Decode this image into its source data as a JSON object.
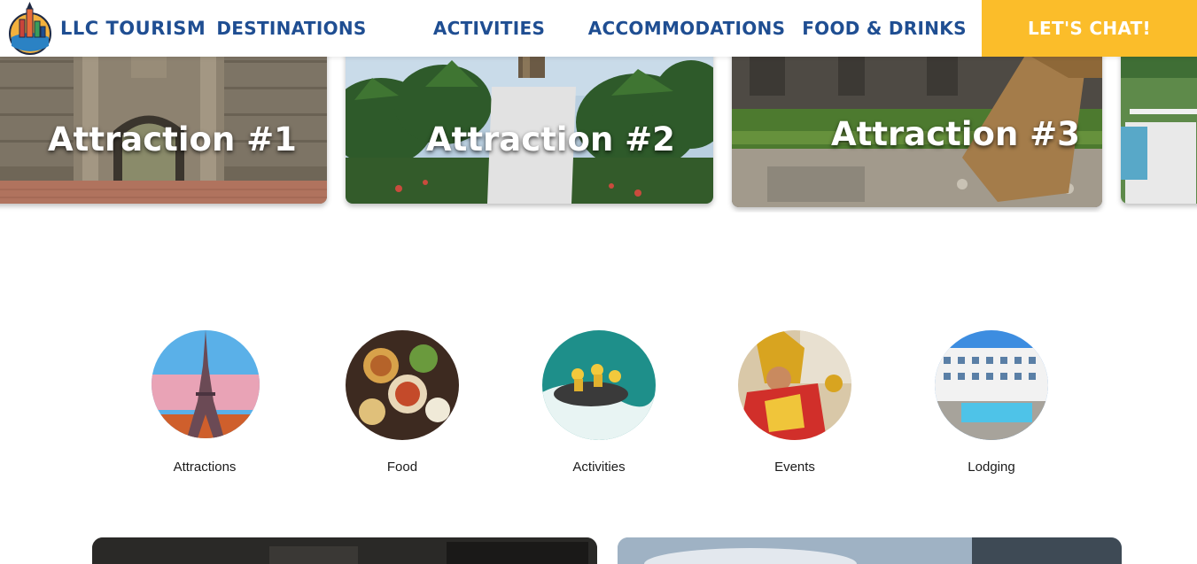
{
  "nav": {
    "brand": "LLC TOURISM",
    "links": [
      "DESTINATIONS",
      "ACTIVITIES",
      "ACCOMMODATIONS",
      "FOOD & DRINKS"
    ],
    "cta": "LET'S CHAT!"
  },
  "carousel": {
    "slides": [
      "Attraction #1",
      "Attraction #2",
      "Attraction #3"
    ],
    "dot_count": 6,
    "active_dot": 2
  },
  "categories": [
    "Attractions",
    "Food",
    "Activities",
    "Events",
    "Lodging"
  ],
  "colors": {
    "brand_blue": "#1f4e92",
    "cta_yellow": "#fbbd2a",
    "dot_active": "#3ea7e8",
    "dot_inactive": "#c4c4c4"
  }
}
